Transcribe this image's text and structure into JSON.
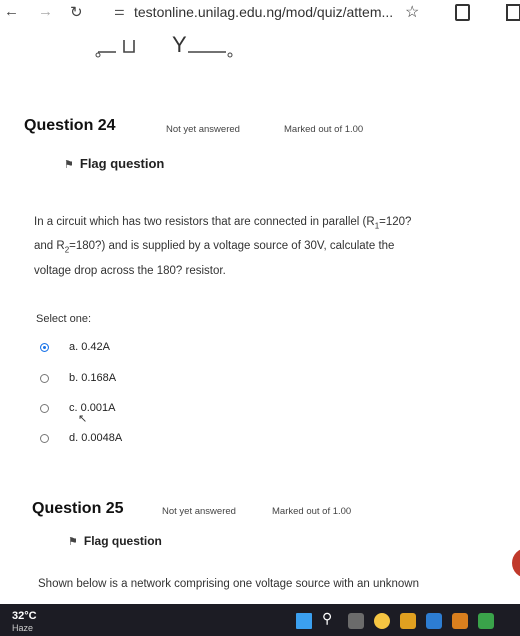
{
  "browser": {
    "url": "testonline.unilag.edu.ng/mod/quiz/attem..."
  },
  "logo": {
    "text": "Y"
  },
  "q24": {
    "title": "Question 24",
    "status": "Not yet answered",
    "marked": "Marked out of 1.00",
    "flag": "Flag question",
    "text_line1": "In a circuit which has two resistors that are connected in parallel (R",
    "text_sub1": "1",
    "text_line1b": "=120?",
    "text_line2a": "and R",
    "text_sub2": "2",
    "text_line2b": "=180?) and is supplied by a voltage source of 30V, calculate the",
    "text_line3": "voltage drop across the 180? resistor.",
    "select_one": "Select one:",
    "options": [
      {
        "label": "a. 0.42A",
        "selected": true
      },
      {
        "label": "b. 0.168A",
        "selected": false
      },
      {
        "label": "c. 0.001A",
        "selected": false
      },
      {
        "label": "d. 0.0048A",
        "selected": false
      }
    ]
  },
  "q25": {
    "title": "Question 25",
    "status": "Not yet answered",
    "marked": "Marked out of 1.00",
    "flag": "Flag question",
    "text": "Shown below is a network comprising one voltage source with an unknown"
  },
  "taskbar": {
    "temp": "32°C",
    "condition": "Haze"
  },
  "colors": {
    "radio_selected": "#1a73e8",
    "taskbar": "#1c1c24",
    "accent_red": "#c0392b"
  }
}
